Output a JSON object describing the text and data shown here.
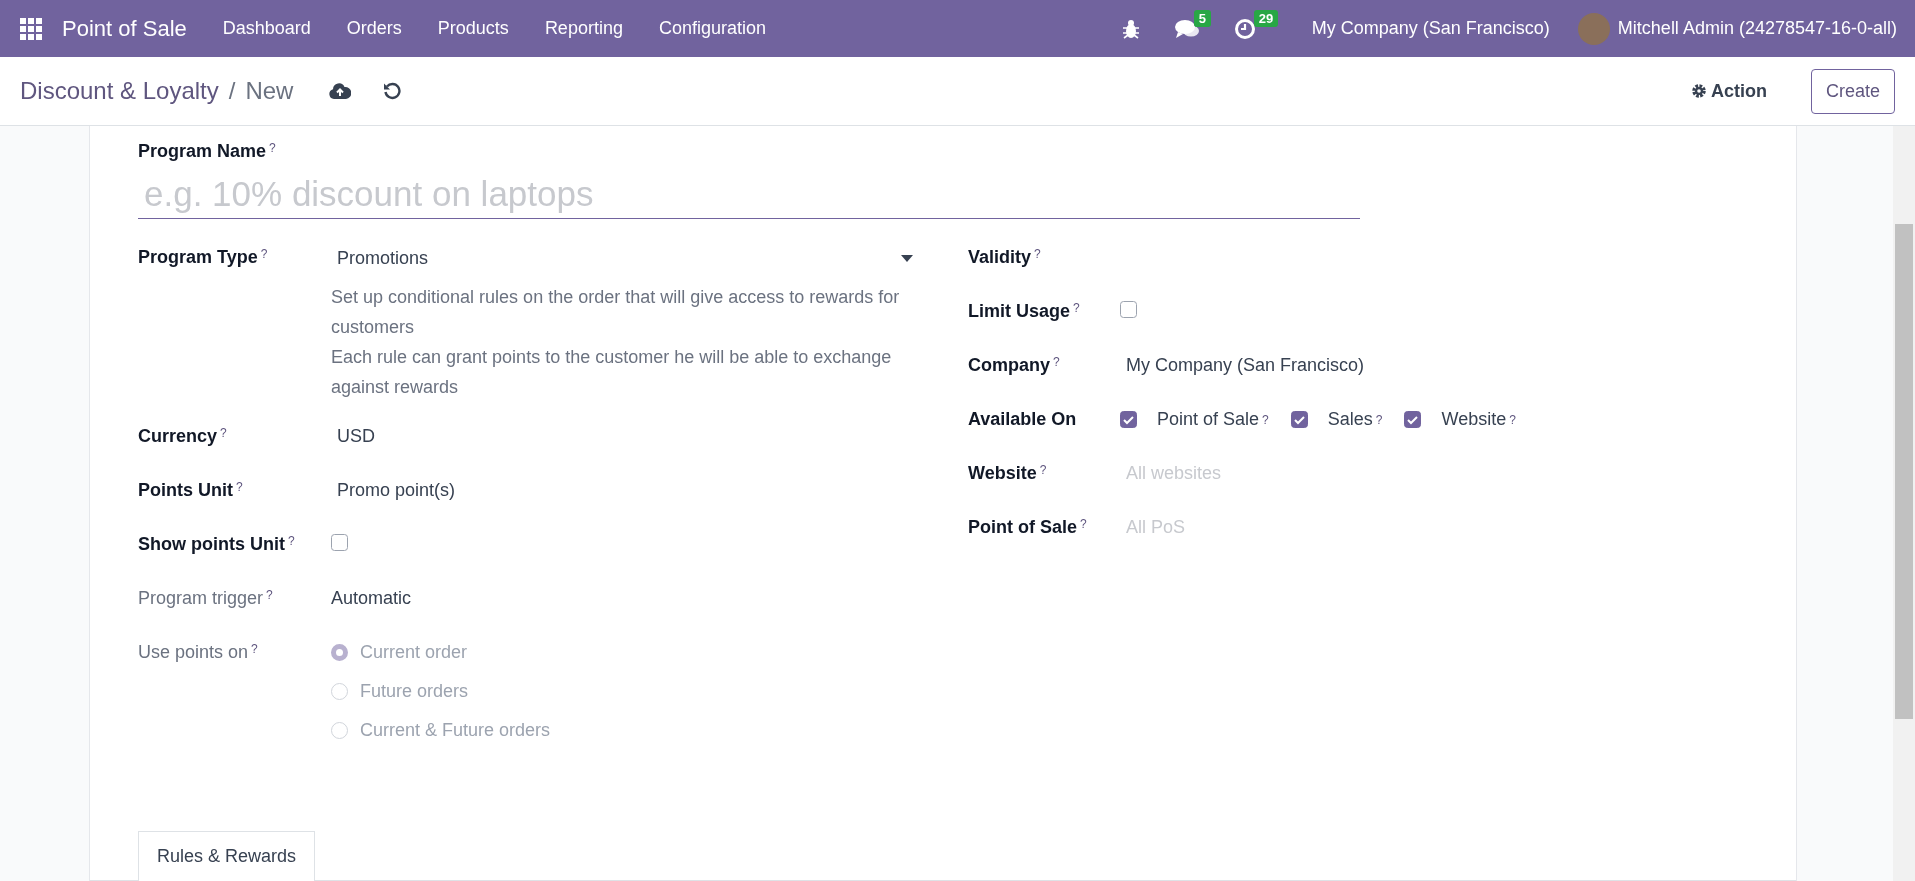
{
  "navbar": {
    "brand": "Point of Sale",
    "menu": [
      "Dashboard",
      "Orders",
      "Products",
      "Reporting",
      "Configuration"
    ],
    "messages_badge": "5",
    "activities_badge": "29",
    "company": "My Company (San Francisco)",
    "user": "Mitchell Admin (24278547-16-0-all)"
  },
  "control_panel": {
    "breadcrumb": [
      "Discount & Loyalty",
      "New"
    ],
    "separator": "/",
    "action": "Action",
    "create": "Create"
  },
  "form": {
    "program_name": {
      "label": "Program Name",
      "help": "?",
      "placeholder": "e.g. 10% discount on laptops"
    },
    "left": [
      {
        "kind": "select",
        "label": "Program Type",
        "help": "?",
        "value": "Promotions",
        "muted": false,
        "description": [
          "Set up conditional rules on the order that will give access to rewards for customers",
          "Each rule can grant points to the customer he will be able to exchange against rewards"
        ]
      },
      {
        "kind": "text",
        "label": "Currency",
        "help": "?",
        "value": "USD",
        "muted": false
      },
      {
        "kind": "text",
        "label": "Points Unit",
        "help": "?",
        "value": "Promo point(s)",
        "muted": false
      },
      {
        "kind": "checkbox",
        "label": "Show points Unit",
        "help": "?",
        "checked": false,
        "muted": false
      },
      {
        "kind": "readonly",
        "label": "Program trigger",
        "help": "?",
        "value": "Automatic",
        "muted": true
      },
      {
        "kind": "radio",
        "label": "Use points on",
        "help": "?",
        "muted": true,
        "options": [
          {
            "label": "Current order",
            "selected": true,
            "disabled": true
          },
          {
            "label": "Future orders",
            "selected": false,
            "disabled": true
          },
          {
            "label": "Current & Future orders",
            "selected": false,
            "disabled": true
          }
        ]
      }
    ],
    "right": [
      {
        "kind": "empty",
        "label": "Validity",
        "help": "?",
        "muted": false
      },
      {
        "kind": "checkbox",
        "label": "Limit Usage",
        "help": "?",
        "checked": false,
        "muted": false
      },
      {
        "kind": "text",
        "label": "Company",
        "help": "?",
        "value": "My Company (San Francisco)",
        "muted": false
      },
      {
        "kind": "checks",
        "label": "Available On",
        "muted": false,
        "options": [
          {
            "label": "Point of Sale",
            "help": "?",
            "checked": true
          },
          {
            "label": "Sales",
            "help": "?",
            "checked": true
          },
          {
            "label": "Website",
            "help": "?",
            "checked": true
          }
        ]
      },
      {
        "kind": "placeholder",
        "label": "Website",
        "help": "?",
        "placeholder": "All websites",
        "muted": false
      },
      {
        "kind": "placeholder",
        "label": "Point of Sale",
        "help": "?",
        "placeholder": "All PoS",
        "muted": false
      }
    ],
    "tabs": [
      {
        "label": "Rules & Rewards",
        "selected": true
      }
    ]
  }
}
